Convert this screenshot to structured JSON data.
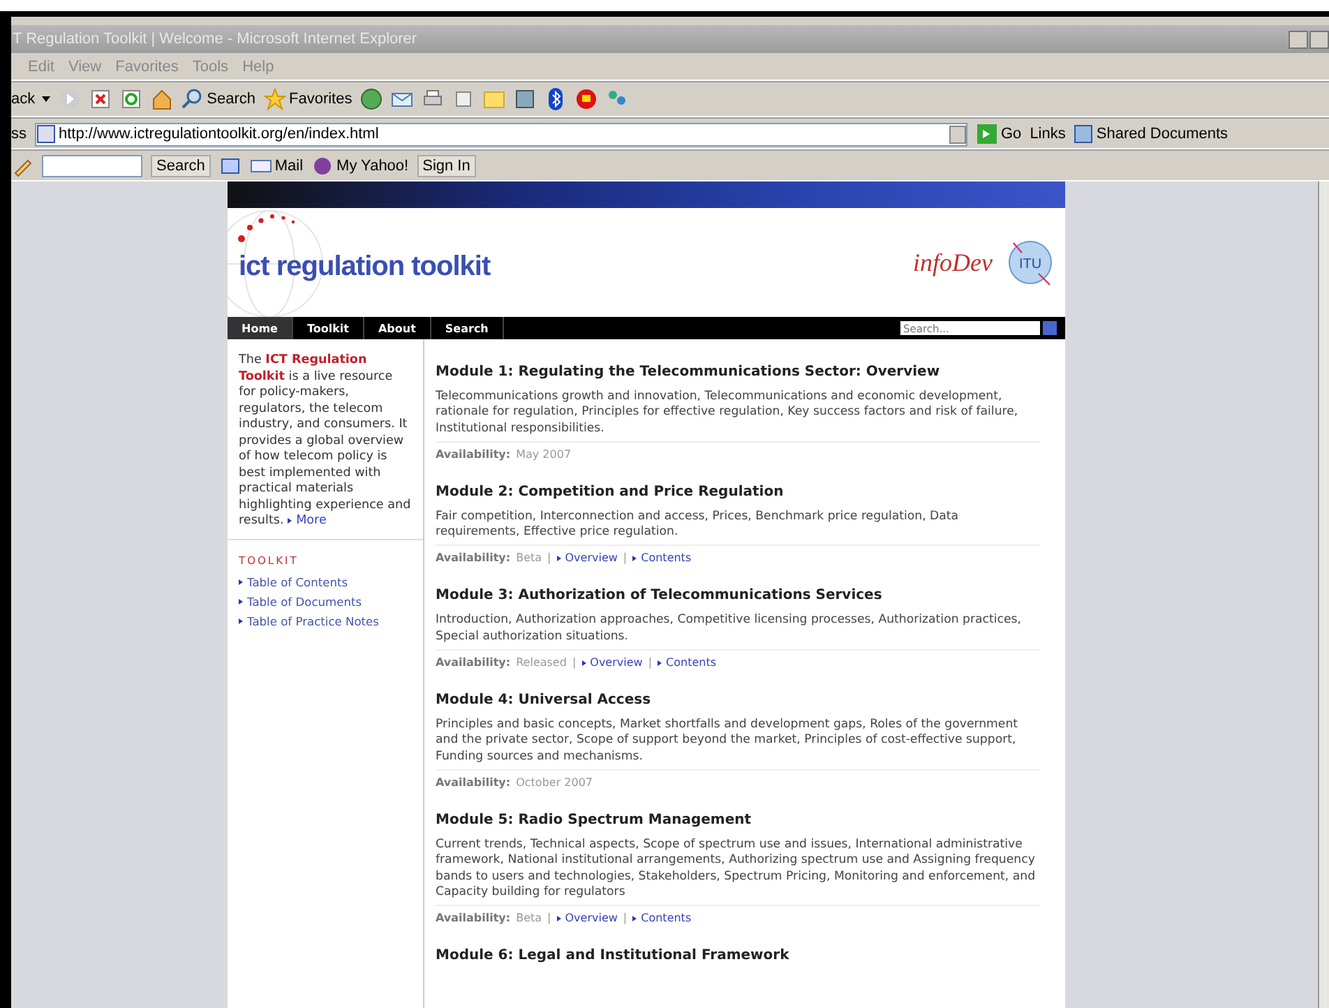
{
  "window": {
    "title": "T Regulation Toolkit | Welcome - Microsoft Internet Explorer"
  },
  "menu_bar": [
    "Edit",
    "View",
    "Favorites",
    "Tools",
    "Help"
  ],
  "toolbar": {
    "back": "ack",
    "search": "Search",
    "favorites": "Favorites"
  },
  "address_bar": {
    "label": "ss",
    "url": "http://www.ictregulationtoolkit.org/en/index.html",
    "go": "Go",
    "links": "Links",
    "shared": "Shared Documents"
  },
  "links_bar": {
    "search": "Search",
    "mail": "Mail",
    "yahoo": "My Yahoo!",
    "sign_in": "Sign In"
  },
  "site": {
    "logo": "ict regulation toolkit",
    "partner": "infoDev",
    "partner2": "ITU",
    "nav": [
      {
        "label": "Home",
        "selected": true
      },
      {
        "label": "Toolkit",
        "selected": false
      },
      {
        "label": "About",
        "selected": false
      },
      {
        "label": "Search",
        "selected": false
      }
    ],
    "search": {
      "placeholder": "Search..."
    },
    "intro": "The **ICT Regulation Toolkit** is a live resource for policy-makers, regulators, the telecom industry, and consumers. It provides a global overview of how telecom policy is best implemented with practical materials highlighting experience and results.",
    "more": "More",
    "toolkit_heading": "TOOLKIT",
    "toolkit_links": [
      "Table of Contents",
      "Table of Documents",
      "Table of Practice Notes"
    ],
    "modules": [
      {
        "title": "Module 1: Regulating the Telecommunications Sector: Overview",
        "description": "Telecommunications growth and innovation, Telecommunications and economic development, rationale for regulation, Principles for effective regulation, Key success factors and risk of failure, Institutional responsibilities.",
        "availability_label": "Availability:",
        "availability": "May 2007"
      },
      {
        "title": "Module 2: Competition and Price Regulation",
        "description": "Fair competition, Interconnection and access, Prices, Benchmark price regulation, Data requirements, Effective price regulation.",
        "availability_label": "Availability:",
        "availability": "Beta",
        "separator": "|",
        "links": [
          "Overview",
          "Contents"
        ]
      },
      {
        "title": "Module 3: Authorization of Telecommunications Services",
        "description": "Introduction, Authorization approaches, Competitive licensing processes, Authorization practices, Special authorization situations.",
        "availability_label": "Availability:",
        "availability": "Released",
        "separator": "|",
        "links": [
          "Overview",
          "Contents"
        ]
      },
      {
        "title": "Module 4: Universal Access",
        "description": "Principles and basic concepts, Market shortfalls and development gaps, Roles of the government and the private sector, Scope of support beyond the market, Principles of cost-effective support, Funding sources and mechanisms.",
        "availability_label": "Availability:",
        "availability": "October 2007"
      },
      {
        "title": "Module 5: Radio Spectrum Management",
        "description": "Current trends, Technical aspects, Scope of spectrum use and issues, International administrative framework, National institutional arrangements, Authorizing spectrum use and Assigning frequency bands to users and technologies, Stakeholders, Spectrum Pricing, Monitoring and enforcement, and Capacity building for regulators",
        "availability_label": "Availability:",
        "availability": "Beta",
        "separator": "|",
        "links": [
          "Overview",
          "Contents"
        ]
      },
      {
        "title": "Module 6: Legal and Institutional Framework"
      }
    ]
  }
}
